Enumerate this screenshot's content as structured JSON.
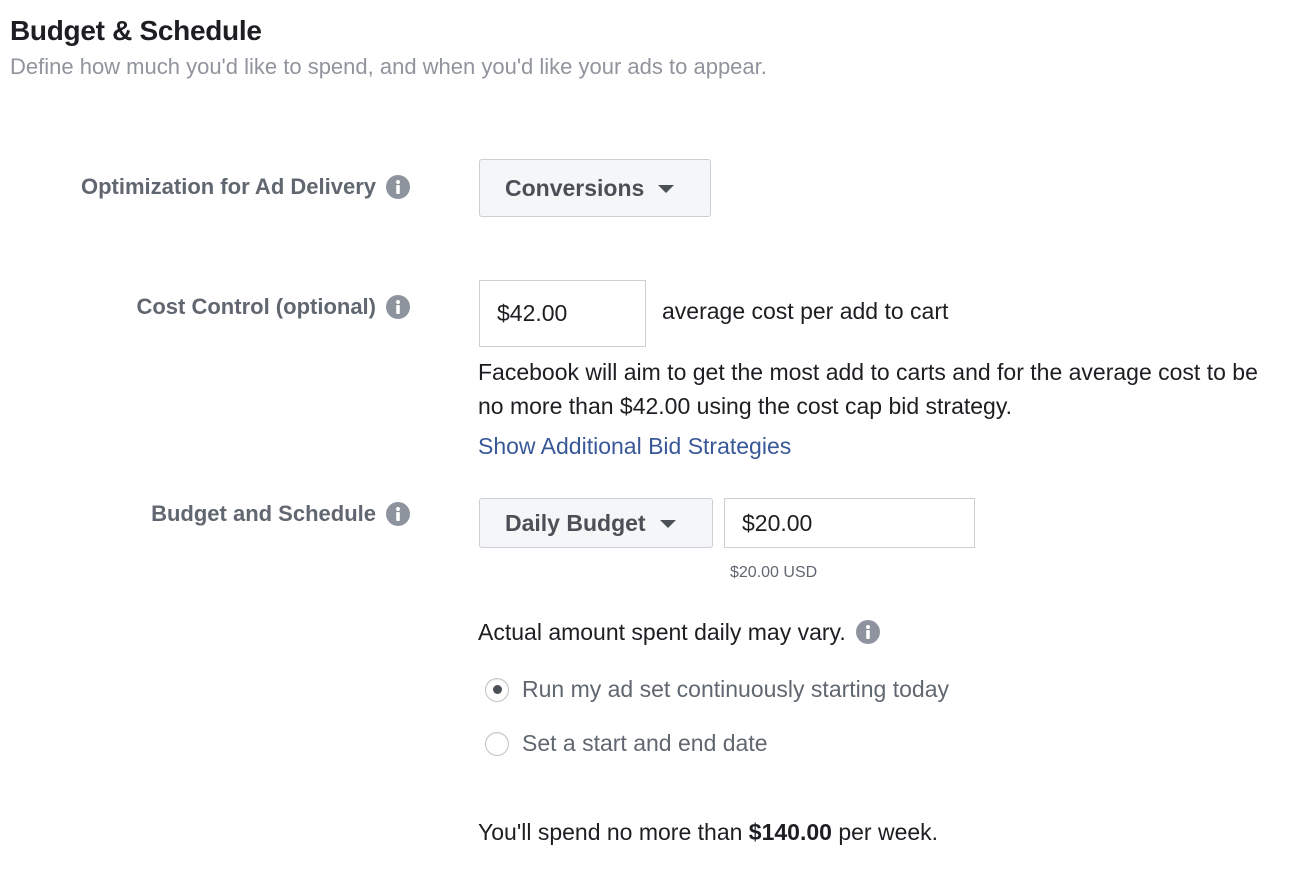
{
  "header": {
    "title": "Budget & Schedule",
    "subtitle": "Define how much you'd like to spend, and when you'd like your ads to appear."
  },
  "optimization": {
    "label": "Optimization for Ad Delivery",
    "info_icon": "info-icon",
    "selected": "Conversions"
  },
  "cost_control": {
    "label": "Cost Control (optional)",
    "info_icon": "info-icon",
    "value": "$42.00",
    "suffix": "average cost per add to cart",
    "description": "Facebook will aim to get the most add to carts and for the average cost to be no more than $42.00 using the cost cap bid strategy.",
    "link": "Show Additional Bid Strategies"
  },
  "budget": {
    "label": "Budget and Schedule",
    "info_icon": "info-icon",
    "type_selected": "Daily Budget",
    "amount": "$20.00",
    "amount_hint": "$20.00 USD",
    "vary_note": "Actual amount spent daily may vary.",
    "schedule_options": [
      {
        "label": "Run my ad set continuously starting today",
        "selected": true
      },
      {
        "label": "Set a start and end date",
        "selected": false
      }
    ],
    "weekly_prefix": "You'll spend no more than",
    "weekly_amount": "$140.00",
    "weekly_suffix": "per week."
  },
  "colors": {
    "link": "#385898",
    "label": "#606770",
    "info_icon": "#8d949e"
  }
}
